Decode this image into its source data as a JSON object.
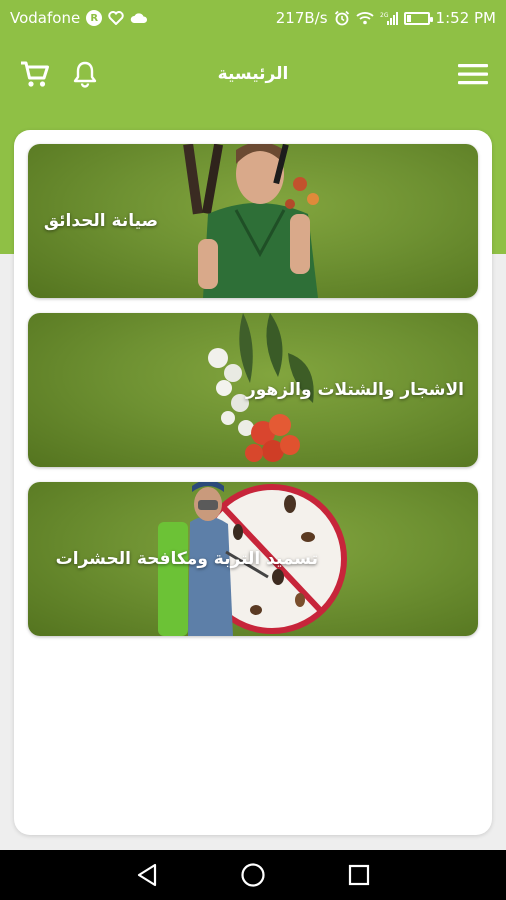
{
  "status_bar": {
    "carrier": "Vodafone",
    "carrier_badge": "R",
    "net_speed": "217B/s",
    "time": "1:52 PM",
    "network_type": "2G"
  },
  "app_bar": {
    "title": "الرئيسية"
  },
  "tiles": [
    {
      "label": "صيانة الحدائق",
      "icon": "gardener-image"
    },
    {
      "label": "الاشجار والشتلات والزهور",
      "icon": "flowers-image"
    },
    {
      "label": "تسميد التربة ومكافحة الحشرات",
      "icon": "pest-control-image"
    }
  ],
  "colors": {
    "primary": "#8fc045",
    "tile_green": "#6e9132",
    "background": "#eeeeee",
    "nav_bar": "#000000"
  },
  "icons": {
    "menu": "hamburger-menu-icon",
    "cart": "cart-icon",
    "notifications": "bell-icon",
    "nav_back": "back-triangle-icon",
    "nav_home": "home-circle-icon",
    "nav_recents": "recents-square-icon"
  }
}
